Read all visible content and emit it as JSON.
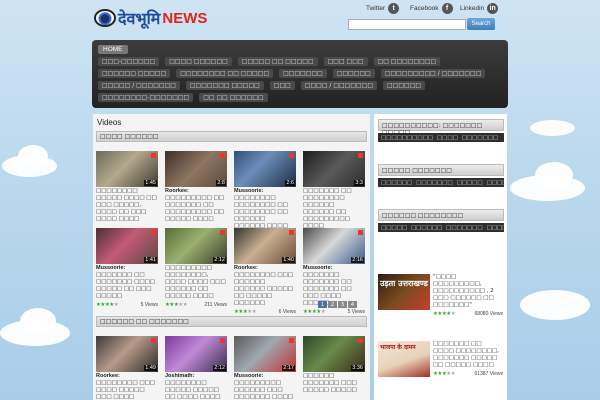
{
  "brand": {
    "hindi": "देवभूमि",
    "news": "NEWS"
  },
  "social": [
    {
      "label": "Twitter",
      "icon": "twitter-icon",
      "glyph": "t"
    },
    {
      "label": "Facebook",
      "icon": "facebook-icon",
      "glyph": "f"
    },
    {
      "label": "Linkedin",
      "icon": "linkedin-icon",
      "glyph": "in"
    }
  ],
  "search": {
    "button": "Search",
    "placeholder": ""
  },
  "nav": {
    "home": "HOME",
    "items": [
      "□□□-□□□□□□",
      "□□□□ □□□□□□",
      "□□□□□ □□ □□□□□",
      "□□□ □□□",
      "□□ □□□□□□□□",
      "□□□□□□ □□□□□",
      "□□□□□□□□ □□ □□□□□",
      "□□□□□□□",
      "□□□□□□",
      "□□□□□□□□□ / □□□□□□□",
      "□□□□□ / □□□□□□□",
      "□□□□□□□ □□□□□",
      "□□□",
      "□□□□ / □□□□□□□",
      "□□□□□□",
      "□□□□□□□□-□□□□□□□",
      "□□ □□ □□□□□□"
    ]
  },
  "videos": {
    "title": "Videos",
    "tab1": "□□□□ □□□□□□",
    "tab2": "□□□□□□ □□ □□□□□□□",
    "row1": [
      {
        "dur": "1:45",
        "place": "",
        "caption": "□□□□□□□□ □□□□□ □□□□ □□ □□□ □□□□□, □□□□ □□ □□□ □□□□ □□□□"
      },
      {
        "dur": "2:8",
        "place": "Roorkee:",
        "caption": "□□□□□□□□□ □□ □□□□□□□ □□ □□□□□□□□□ □□ □□□□□ □□□□"
      },
      {
        "dur": "2:6",
        "place": "Mussoorie:",
        "caption": "□□□□□□□□ □□□□□□□□ □□ □□□□□□□□ □□ □□□□□□ □□□□□□ □□□□"
      },
      {
        "dur": "3:3",
        "place": "",
        "caption": "□□□□□□□ □□ □□□□□□□□ □□□□□□ □□□□□□ □□ □□□□□□□□□ □□□□"
      }
    ],
    "row2": [
      {
        "dur": "1:41",
        "place": "Mussoorie:",
        "caption": "□□□□□□□ □□ □□□□□□□ □□□□ □□□□□ □□ □□□ □□□□□",
        "views": "5 Views",
        "rating": 4
      },
      {
        "dur": "2:12",
        "place": "",
        "caption": "□□□□□□□□□ □□□□□□□□, □□□□ □□□□ □□□ □□□□□□ □□ □□□□□ □□□□",
        "views": "211 Views",
        "rating": 3
      },
      {
        "dur": "1:40",
        "place": "Roorkee:",
        "caption": "□□□□□□□□ □□□ □□□□□□ □□□□□□ □□□□□ □□ □□□□□ □□□□□□",
        "views": "6 Views",
        "rating": 3
      },
      {
        "dur": "2:16",
        "place": "Mussoorie:",
        "caption": "□□□□□□□ □□□□□□□ □□ □□□□□□□ □□ □□□ □□□□ □□□□□",
        "views": "5 Views",
        "rating": 4
      }
    ],
    "row3": [
      {
        "dur": "1:49",
        "place": "Roorkee:",
        "caption": "□□□□□□□□ □□□ □□□□ □□□□□ □□□ □□□□"
      },
      {
        "dur": "2:12",
        "place": "Joshimath:",
        "caption": "□□□□□□□□ □□□□□ □□□□□ □□ □□□□ □□□□"
      },
      {
        "dur": "2:17",
        "place": "Mussoorie:",
        "caption": "□□□□□□□□□ □□□□□□ □□□ □□□□□□□ □□□□"
      },
      {
        "dur": "3:36",
        "place": "",
        "caption": "□□□□□□ □□□□□□□ □□□ □□□□□ □□□□□"
      }
    ],
    "pager": [
      "1",
      "2",
      "3",
      "4"
    ]
  },
  "sidebar": {
    "box1": {
      "title": "□□□□□□□□□□: □□□□□□□ □□□□□",
      "bar": [
        "□□□□□□□□□□",
        "□□□□",
        "□□□□□□□"
      ]
    },
    "box2": {
      "title": "□□□□□ □□□□□□□",
      "bar": [
        "□□□□□□",
        "□□□□□□□",
        "□□□□□",
        "□□□□"
      ]
    },
    "box3": {
      "title": "□□□□□□ □□□□□□□□",
      "bar": [
        "□□□□□",
        "□□□□□□",
        "□□□□□□□",
        "□□□□"
      ]
    },
    "vid1": {
      "thumbtext": "उड़ता उत्तराखण्ड",
      "caption": "\"□□□□ □□□□□□□□□, □□□□□□□□□□ , 2 □□□ □□□□□□ □□ □□□□□□□\"",
      "views": "68080 Views"
    },
    "vid2": {
      "thumbtext": "भाजपा के दामन",
      "caption": "□□□□□□□ □□ □□□□ □□□□□□□□, □□□□□□□ □□□□□ □□ □□□□□ □□□□",
      "views": "61387 Views"
    }
  }
}
